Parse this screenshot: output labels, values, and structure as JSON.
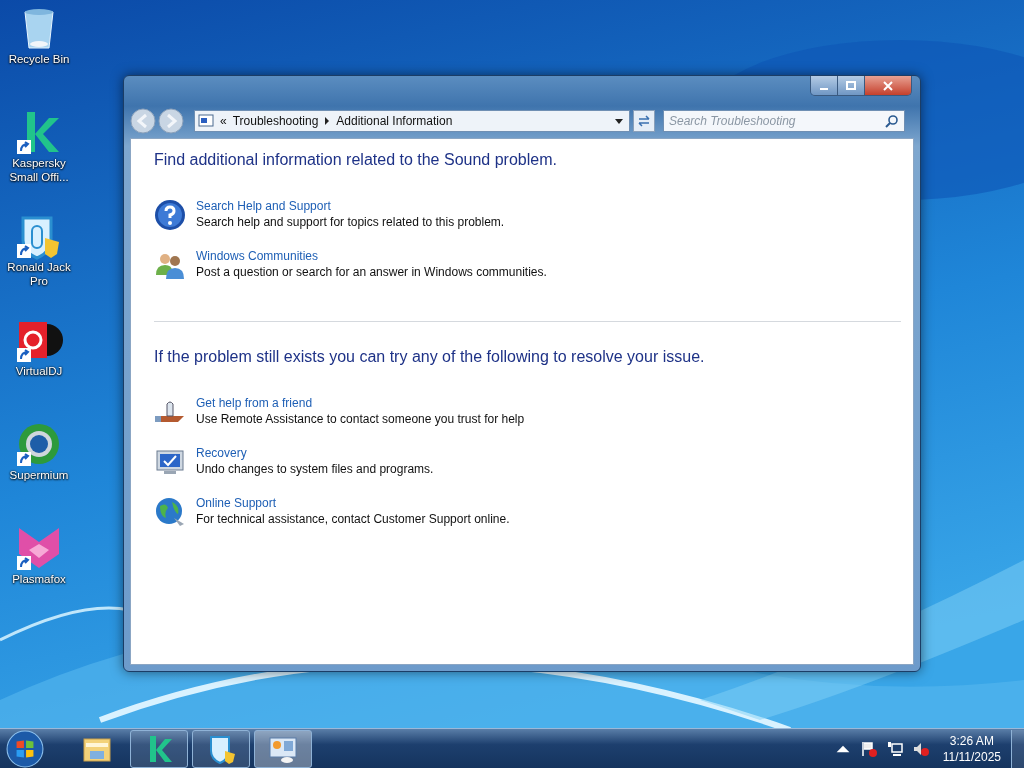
{
  "desktop_icons": [
    {
      "kind": "recycle",
      "label": "Recycle Bin",
      "shortcut": false
    },
    {
      "kind": "kaspersky",
      "label": "Kaspersky Small Offi...",
      "shortcut": true
    },
    {
      "kind": "shield",
      "label": "Ronald Jack Pro",
      "shortcut": true
    },
    {
      "kind": "dj",
      "label": "VirtualDJ",
      "shortcut": true
    },
    {
      "kind": "browser",
      "label": "Supermium",
      "shortcut": true
    },
    {
      "kind": "fox",
      "label": "Plasmafox",
      "shortcut": true
    }
  ],
  "window": {
    "address": {
      "chevron": "«",
      "crumbs": [
        "Troubleshooting",
        "Additional Information"
      ]
    },
    "search": {
      "placeholder": "Search Troubleshooting"
    },
    "sections": [
      {
        "heading": "Find additional information related to the Sound problem.",
        "links": [
          {
            "kind": "help",
            "title": "Search Help and Support",
            "description": "Search help and support for topics related to this problem."
          },
          {
            "kind": "people",
            "title": "Windows Communities",
            "description": "Post a question or search for an answer in Windows communities."
          }
        ]
      },
      {
        "heading": "If the problem still exists you can try any of the following to resolve your issue.",
        "links": [
          {
            "kind": "friend",
            "title": "Get help from a friend",
            "description": "Use Remote Assistance to contact someone you trust for help"
          },
          {
            "kind": "recovery",
            "title": "Recovery",
            "description": "Undo changes to system files and programs."
          },
          {
            "kind": "globe",
            "title": "Online Support",
            "description": "For technical assistance, contact Customer Support online."
          }
        ]
      }
    ]
  },
  "taskbar": {
    "items": [
      {
        "kind": "explorer",
        "running": false,
        "selected": false
      },
      {
        "kind": "kaspersky",
        "running": true,
        "selected": false
      },
      {
        "kind": "shield",
        "running": true,
        "selected": false
      },
      {
        "kind": "troubleshoot",
        "running": true,
        "selected": true
      }
    ],
    "clock": {
      "time": "3:26 AM",
      "date": "11/11/2025"
    }
  }
}
